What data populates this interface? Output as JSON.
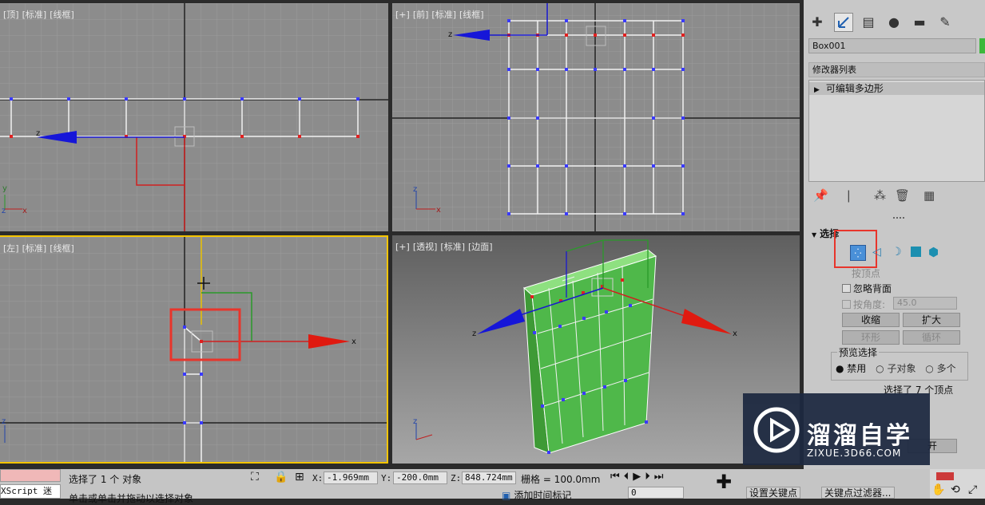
{
  "viewports": {
    "top": {
      "labels": [
        "[顶]",
        "[标准]",
        "[线框]"
      ]
    },
    "front": {
      "labels": [
        "[+]",
        "[前]",
        "[标准]",
        "[线框]"
      ]
    },
    "left": {
      "labels": [
        "[左]",
        "[标准]",
        "[线框]"
      ]
    },
    "persp": {
      "labels": [
        "[+]",
        "[透视]",
        "[标准]",
        "[边面]"
      ]
    }
  },
  "axis_letters": {
    "x": "x",
    "y": "y",
    "z": "z"
  },
  "command_panel": {
    "tabs": [
      "create-icon",
      "modify-icon",
      "hierarchy-icon",
      "motion-icon",
      "display-icon",
      "utilities-icon"
    ],
    "object_name": "Box001",
    "modifier_list": "修改器列表",
    "stack_item": "可编辑多边形",
    "selection_rollout": "选择",
    "by_vertex": "按顶点",
    "ignore_backfacing": "忽略背面",
    "by_angle": "按角度:",
    "angle_value": "45.0",
    "shrink": "收缩",
    "grow": "扩大",
    "ring": "环形",
    "loop": "循环",
    "preview_selection": "预览选择",
    "preview_options": [
      "禁用",
      "子对象",
      "多个"
    ],
    "selected_info": "选择了 7 个顶点",
    "partial_button": "开"
  },
  "status": {
    "maxscript": "XScript 迷",
    "selected": "选择了 1 个 对象",
    "hint": "单击或单击并拖动以选择对象",
    "x_label": "X:",
    "x_value": "-1.969mm",
    "y_label": "Y:",
    "y_value": "-200.0mm",
    "z_label": "Z:",
    "z_value": "848.724mm",
    "grid": "栅格 = 100.0mm",
    "auto_key": "添加时间标记",
    "frame_value": "0",
    "set_key": "设置关键点",
    "key_filters": "关键点过滤器..."
  },
  "watermark": {
    "brand": "溜溜自学",
    "url": "ZIXUE.3D66.COM"
  },
  "colors": {
    "selection_red": "#e8352b",
    "viewport_active": "#f5c400",
    "model_green": "#4fb84a"
  }
}
